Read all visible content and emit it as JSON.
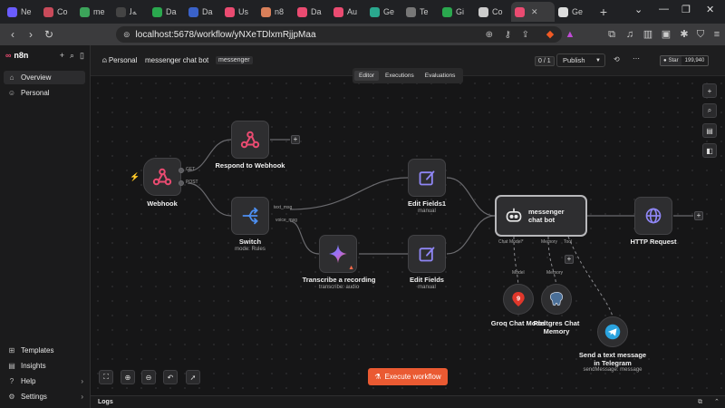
{
  "browser": {
    "tabs": [
      {
        "label": "Ne",
        "fav": "#6a5cff"
      },
      {
        "label": "Co",
        "fav": "#c84a5a"
      },
      {
        "label": "me",
        "fav": "#3ca45a"
      },
      {
        "label": "ﻪﻟ",
        "fav": "#444"
      },
      {
        "label": "Da",
        "fav": "#2aa84e"
      },
      {
        "label": "Da",
        "fav": "#3a62c9"
      },
      {
        "label": "Us",
        "fav": "#ea4b71"
      },
      {
        "label": "n8",
        "fav": "#d9805a"
      },
      {
        "label": "Da",
        "fav": "#ea4b71"
      },
      {
        "label": "Au",
        "fav": "#ea4b71"
      },
      {
        "label": "Ge",
        "fav": "#2aa88e"
      },
      {
        "label": "Te",
        "fav": "#777"
      },
      {
        "label": "Gi",
        "fav": "#2aa84e"
      },
      {
        "label": "Co",
        "fav": "#ccc"
      },
      {
        "label": "",
        "fav": "#ea4b71",
        "active": true
      },
      {
        "label": "Ge",
        "fav": "#ddd"
      }
    ],
    "url": "localhost:5678/workflow/yNXeTDlxmRjjpMaa"
  },
  "sidebar": {
    "app": "n8n",
    "top_items": [
      {
        "label": "Overview",
        "icon": "home-icon"
      },
      {
        "label": "Personal",
        "icon": "user-icon"
      }
    ],
    "bottom_items": [
      {
        "label": "Templates",
        "icon": "templates-icon"
      },
      {
        "label": "Insights",
        "icon": "insights-icon"
      },
      {
        "label": "Help",
        "icon": "help-icon"
      },
      {
        "label": "Settings",
        "icon": "settings-icon"
      }
    ]
  },
  "header": {
    "project": "Personal",
    "workflow_name": "messenger chat bot",
    "tag": "messenger",
    "version_count": "0 / 1",
    "publish_label": "Publish",
    "star_label": "Star",
    "star_count": "199,940"
  },
  "view_tabs": [
    "Editor",
    "Executions",
    "Evaluations"
  ],
  "nodes": {
    "webhook": {
      "label": "Webhook",
      "out1": "GET",
      "out2": "POST"
    },
    "respond": {
      "label": "Respond to Webhook"
    },
    "switch": {
      "label": "Switch",
      "sub": "mode: Rules",
      "out1": "text_msg",
      "out2": "voice_msg"
    },
    "transcribe": {
      "label": "Transcribe a recording",
      "sub": "transcribe: audio"
    },
    "edit1": {
      "label": "Edit Fields1",
      "sub": "manual"
    },
    "edit2": {
      "label": "Edit Fields",
      "sub": "manual"
    },
    "agent": {
      "label": "messenger chat bot",
      "in1": "Chat Model*",
      "in2": "Memory",
      "in3": "Tool"
    },
    "http": {
      "label": "HTTP Request"
    },
    "groq": {
      "label": "Groq Chat Model",
      "conn": "Model"
    },
    "postgres": {
      "label": "Postgres Chat Memory",
      "conn": "Memory"
    },
    "telegram": {
      "label": "Send a text message in Telegram",
      "sub": "sendMessage: message"
    }
  },
  "execute_label": "Execute workflow",
  "logs_label": "Logs",
  "colors": {
    "accent": "#ea5a32",
    "brand": "#ea4b71",
    "trigger": "#f06b3b"
  }
}
